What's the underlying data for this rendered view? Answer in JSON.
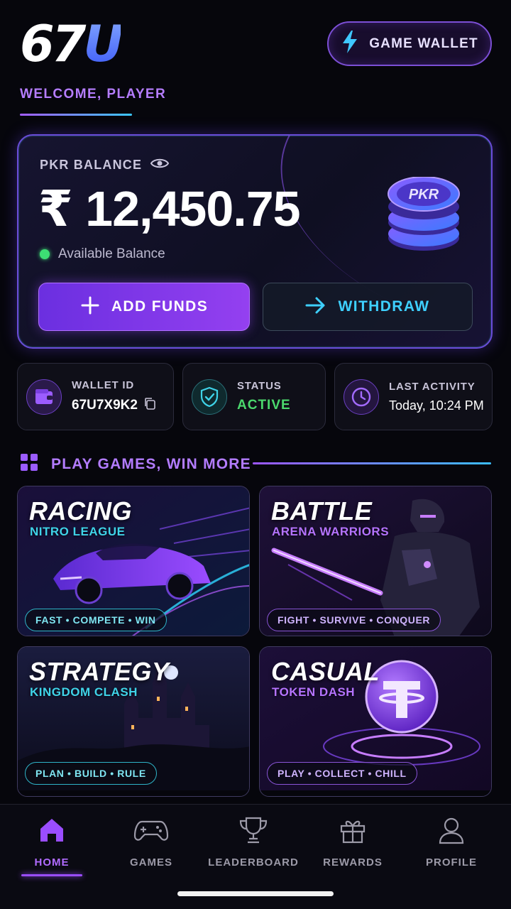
{
  "header": {
    "logo_num": "67",
    "logo_letter": "U",
    "wallet_button": "GAME WALLET",
    "welcome": "WELCOME, PLAYER"
  },
  "balance_card": {
    "label": "PKR BALANCE",
    "amount": "₹ 12,450.75",
    "available": "Available Balance",
    "coin_label": "PKR",
    "add_funds": "ADD FUNDS",
    "withdraw": "WITHDRAW"
  },
  "tiles": [
    {
      "title": "WALLET ID",
      "value": "67U7X9K2"
    },
    {
      "title": "STATUS",
      "value": "ACTIVE"
    },
    {
      "title": "LAST ACTIVITY",
      "value": "Today, 10:24 PM"
    }
  ],
  "section": {
    "title": "PLAY GAMES, WIN MORE"
  },
  "games": [
    {
      "title": "RACING",
      "subtitle": "NITRO LEAGUE",
      "tags": "FAST • COMPETE • WIN"
    },
    {
      "title": "BATTLE",
      "subtitle": "ARENA WARRIORS",
      "tags": "FIGHT • SURVIVE • CONQUER"
    },
    {
      "title": "STRATEGY",
      "subtitle": "KINGDOM CLASH",
      "tags": "PLAN • BUILD • RULE"
    },
    {
      "title": "CASUAL",
      "subtitle": "TOKEN DASH",
      "tags": "PLAY • COLLECT • CHILL"
    }
  ],
  "nav": [
    {
      "label": "HOME",
      "icon": "home-icon",
      "active": true
    },
    {
      "label": "GAMES",
      "icon": "gamepad-icon"
    },
    {
      "label": "LEADERBOARD",
      "icon": "trophy-icon"
    },
    {
      "label": "REWARDS",
      "icon": "gift-icon"
    },
    {
      "label": "PROFILE",
      "icon": "user-icon"
    }
  ],
  "colors": {
    "accent_purple": "#9a4dff",
    "accent_cyan": "#3ed0ff",
    "status_green": "#4bd86d",
    "background": "#06060c"
  }
}
